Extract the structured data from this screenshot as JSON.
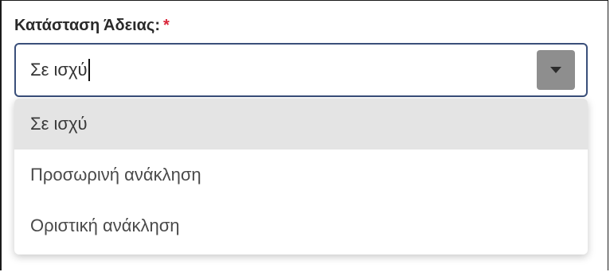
{
  "field": {
    "label": "Κατάσταση Άδειας:",
    "required_mark": "*",
    "value": "Σε ισχύ",
    "toggle_icon": "chevron-down-icon"
  },
  "dropdown": {
    "options": [
      {
        "label": "Σε ισχύ",
        "selected": true
      },
      {
        "label": "Προσωρινή ανάκληση",
        "selected": false
      },
      {
        "label": "Οριστική ανάκληση",
        "selected": false
      }
    ]
  },
  "colors": {
    "border_focus": "#3a4f7a",
    "required": "#d9263a",
    "toggle_bg": "#8e8e8e",
    "selected_bg": "#e4e4e4"
  }
}
